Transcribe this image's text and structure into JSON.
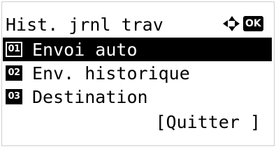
{
  "screen": {
    "title": "Hist. jrnl trav",
    "ok_label": "OK",
    "nav_icon": "four-way-arrow-icon"
  },
  "menu": {
    "items": [
      {
        "number": "01",
        "label": "Envoi auto",
        "selected": true
      },
      {
        "number": "02",
        "label": "Env. historique",
        "selected": false
      },
      {
        "number": "03",
        "label": "Destination",
        "selected": false
      }
    ]
  },
  "softkey": {
    "quit_label": "[Quitter ]"
  },
  "colors": {
    "background": "#ffffff",
    "foreground": "#000000",
    "highlight_bg": "#000000",
    "highlight_fg": "#ffffff"
  }
}
